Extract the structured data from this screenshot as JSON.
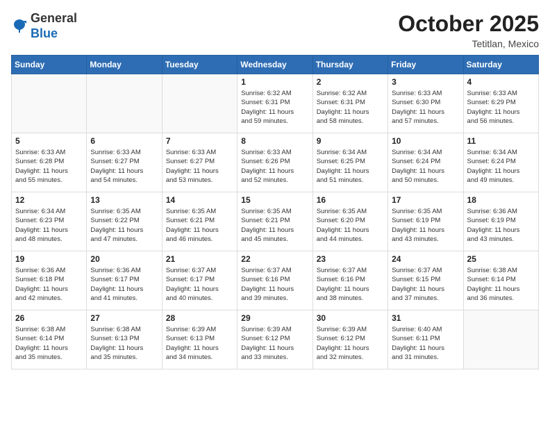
{
  "header": {
    "logo_general": "General",
    "logo_blue": "Blue",
    "month_year": "October 2025",
    "location": "Tetitlan, Mexico"
  },
  "days_of_week": [
    "Sunday",
    "Monday",
    "Tuesday",
    "Wednesday",
    "Thursday",
    "Friday",
    "Saturday"
  ],
  "weeks": [
    [
      {
        "day": "",
        "info": ""
      },
      {
        "day": "",
        "info": ""
      },
      {
        "day": "",
        "info": ""
      },
      {
        "day": "1",
        "info": "Sunrise: 6:32 AM\nSunset: 6:31 PM\nDaylight: 11 hours\nand 59 minutes."
      },
      {
        "day": "2",
        "info": "Sunrise: 6:32 AM\nSunset: 6:31 PM\nDaylight: 11 hours\nand 58 minutes."
      },
      {
        "day": "3",
        "info": "Sunrise: 6:33 AM\nSunset: 6:30 PM\nDaylight: 11 hours\nand 57 minutes."
      },
      {
        "day": "4",
        "info": "Sunrise: 6:33 AM\nSunset: 6:29 PM\nDaylight: 11 hours\nand 56 minutes."
      }
    ],
    [
      {
        "day": "5",
        "info": "Sunrise: 6:33 AM\nSunset: 6:28 PM\nDaylight: 11 hours\nand 55 minutes."
      },
      {
        "day": "6",
        "info": "Sunrise: 6:33 AM\nSunset: 6:27 PM\nDaylight: 11 hours\nand 54 minutes."
      },
      {
        "day": "7",
        "info": "Sunrise: 6:33 AM\nSunset: 6:27 PM\nDaylight: 11 hours\nand 53 minutes."
      },
      {
        "day": "8",
        "info": "Sunrise: 6:33 AM\nSunset: 6:26 PM\nDaylight: 11 hours\nand 52 minutes."
      },
      {
        "day": "9",
        "info": "Sunrise: 6:34 AM\nSunset: 6:25 PM\nDaylight: 11 hours\nand 51 minutes."
      },
      {
        "day": "10",
        "info": "Sunrise: 6:34 AM\nSunset: 6:24 PM\nDaylight: 11 hours\nand 50 minutes."
      },
      {
        "day": "11",
        "info": "Sunrise: 6:34 AM\nSunset: 6:24 PM\nDaylight: 11 hours\nand 49 minutes."
      }
    ],
    [
      {
        "day": "12",
        "info": "Sunrise: 6:34 AM\nSunset: 6:23 PM\nDaylight: 11 hours\nand 48 minutes."
      },
      {
        "day": "13",
        "info": "Sunrise: 6:35 AM\nSunset: 6:22 PM\nDaylight: 11 hours\nand 47 minutes."
      },
      {
        "day": "14",
        "info": "Sunrise: 6:35 AM\nSunset: 6:21 PM\nDaylight: 11 hours\nand 46 minutes."
      },
      {
        "day": "15",
        "info": "Sunrise: 6:35 AM\nSunset: 6:21 PM\nDaylight: 11 hours\nand 45 minutes."
      },
      {
        "day": "16",
        "info": "Sunrise: 6:35 AM\nSunset: 6:20 PM\nDaylight: 11 hours\nand 44 minutes."
      },
      {
        "day": "17",
        "info": "Sunrise: 6:35 AM\nSunset: 6:19 PM\nDaylight: 11 hours\nand 43 minutes."
      },
      {
        "day": "18",
        "info": "Sunrise: 6:36 AM\nSunset: 6:19 PM\nDaylight: 11 hours\nand 43 minutes."
      }
    ],
    [
      {
        "day": "19",
        "info": "Sunrise: 6:36 AM\nSunset: 6:18 PM\nDaylight: 11 hours\nand 42 minutes."
      },
      {
        "day": "20",
        "info": "Sunrise: 6:36 AM\nSunset: 6:17 PM\nDaylight: 11 hours\nand 41 minutes."
      },
      {
        "day": "21",
        "info": "Sunrise: 6:37 AM\nSunset: 6:17 PM\nDaylight: 11 hours\nand 40 minutes."
      },
      {
        "day": "22",
        "info": "Sunrise: 6:37 AM\nSunset: 6:16 PM\nDaylight: 11 hours\nand 39 minutes."
      },
      {
        "day": "23",
        "info": "Sunrise: 6:37 AM\nSunset: 6:16 PM\nDaylight: 11 hours\nand 38 minutes."
      },
      {
        "day": "24",
        "info": "Sunrise: 6:37 AM\nSunset: 6:15 PM\nDaylight: 11 hours\nand 37 minutes."
      },
      {
        "day": "25",
        "info": "Sunrise: 6:38 AM\nSunset: 6:14 PM\nDaylight: 11 hours\nand 36 minutes."
      }
    ],
    [
      {
        "day": "26",
        "info": "Sunrise: 6:38 AM\nSunset: 6:14 PM\nDaylight: 11 hours\nand 35 minutes."
      },
      {
        "day": "27",
        "info": "Sunrise: 6:38 AM\nSunset: 6:13 PM\nDaylight: 11 hours\nand 35 minutes."
      },
      {
        "day": "28",
        "info": "Sunrise: 6:39 AM\nSunset: 6:13 PM\nDaylight: 11 hours\nand 34 minutes."
      },
      {
        "day": "29",
        "info": "Sunrise: 6:39 AM\nSunset: 6:12 PM\nDaylight: 11 hours\nand 33 minutes."
      },
      {
        "day": "30",
        "info": "Sunrise: 6:39 AM\nSunset: 6:12 PM\nDaylight: 11 hours\nand 32 minutes."
      },
      {
        "day": "31",
        "info": "Sunrise: 6:40 AM\nSunset: 6:11 PM\nDaylight: 11 hours\nand 31 minutes."
      },
      {
        "day": "",
        "info": ""
      }
    ]
  ]
}
